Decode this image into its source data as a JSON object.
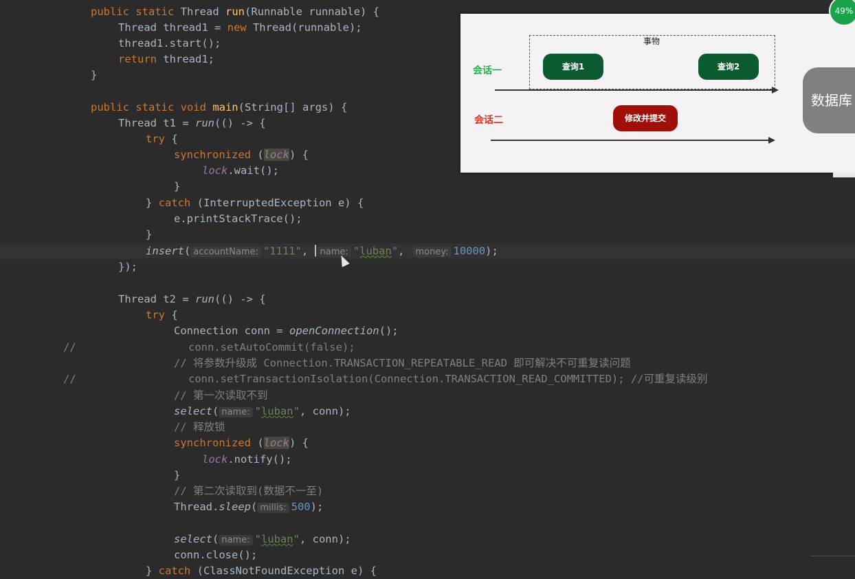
{
  "code": {
    "l1": {
      "a": "public static ",
      "t": "Thread ",
      "fn": "run",
      "b": "(Runnable runnable) {"
    },
    "l2": {
      "a": "Thread thread1 = ",
      "kw": "new ",
      "b": "Thread(runnable);"
    },
    "l3": "thread1.start();",
    "l4": {
      "kw": "return ",
      "b": "thread1;"
    },
    "l5": "}",
    "l6": {
      "a": "public static void ",
      "fn": "main",
      "b": "(String[] args) {"
    },
    "l7": {
      "a": "Thread t1 = ",
      "it": "run",
      "b": "(() -> {"
    },
    "l8": {
      "kw": "try ",
      "b": "{"
    },
    "l9": {
      "kw": "synchronized ",
      "p1": "(",
      "v": "lock",
      "p2": ") {"
    },
    "l10": {
      "v": "lock",
      "b": ".wait();"
    },
    "l11": "}",
    "l12": {
      "a": "} ",
      "kw": "catch ",
      "b": "(InterruptedException e) {"
    },
    "l13": "e.printStackTrace();",
    "l14": "}",
    "l15": {
      "it": "insert",
      "p": "(",
      "h1": "accountName:",
      "s1": "\"1111\"",
      "c1": ", ",
      "h2": "name:",
      "s2q1": "\"",
      "s2": "luban",
      "s2q2": "\"",
      "c2": ",",
      "h3": "money:",
      "n": "10000",
      "e": ");"
    },
    "l16": "});",
    "l17": {
      "a": "Thread t2 = ",
      "it": "run",
      "b": "(() -> {"
    },
    "l18": {
      "kw": "try ",
      "b": "{"
    },
    "l19": {
      "a": "Connection conn = ",
      "it": "openConnection",
      "b": "();"
    },
    "l20": "conn.setAutoCommit(false);",
    "l21": "// 将参数升级成 Connection.TRANSACTION_REPEATABLE_READ 即可解决不可重复读问题",
    "l22": "conn.setTransactionIsolation(Connection.TRANSACTION_READ_COMMITTED); //可重复读级别",
    "l23": "// 第一次读取不到",
    "l24": {
      "it": "select",
      "p": "(",
      "h": "name:",
      "q1": "\"",
      "s": "luban",
      "q2": "\"",
      "e": ", conn);"
    },
    "l25": "// 释放锁",
    "l26": {
      "kw": "synchronized ",
      "p1": "(",
      "v": "lock",
      "p2": ") {"
    },
    "l27": {
      "v": "lock",
      "b": ".notify();"
    },
    "l28": "}",
    "l29": "// 第二次读取到(数据不一至)",
    "l30": {
      "a": "Thread.",
      "it": "sleep",
      "p": "(",
      "h": "millis:",
      "n": "500",
      "e": ");"
    },
    "l31": {
      "it": "select",
      "p": "(",
      "h": "name:",
      "q1": "\"",
      "s": "luban",
      "q2": "\"",
      "e": ", conn);"
    },
    "l32": "conn.close();",
    "l33": {
      "a": "} ",
      "kw": "catch ",
      "b": "(ClassNotFoundException e) {"
    },
    "comment_marker": "//"
  },
  "diagram": {
    "transaction_label": "事物",
    "session1": "会话一",
    "session2": "会话二",
    "query1": "查询1",
    "query2": "查询2",
    "modify": "修改并提交",
    "database": "数据库"
  },
  "badge": "49%",
  "colors": {
    "session1": "#22b24c",
    "session2": "#e0301e",
    "pill_green": "#0c5a30",
    "pill_red": "#a01008"
  }
}
